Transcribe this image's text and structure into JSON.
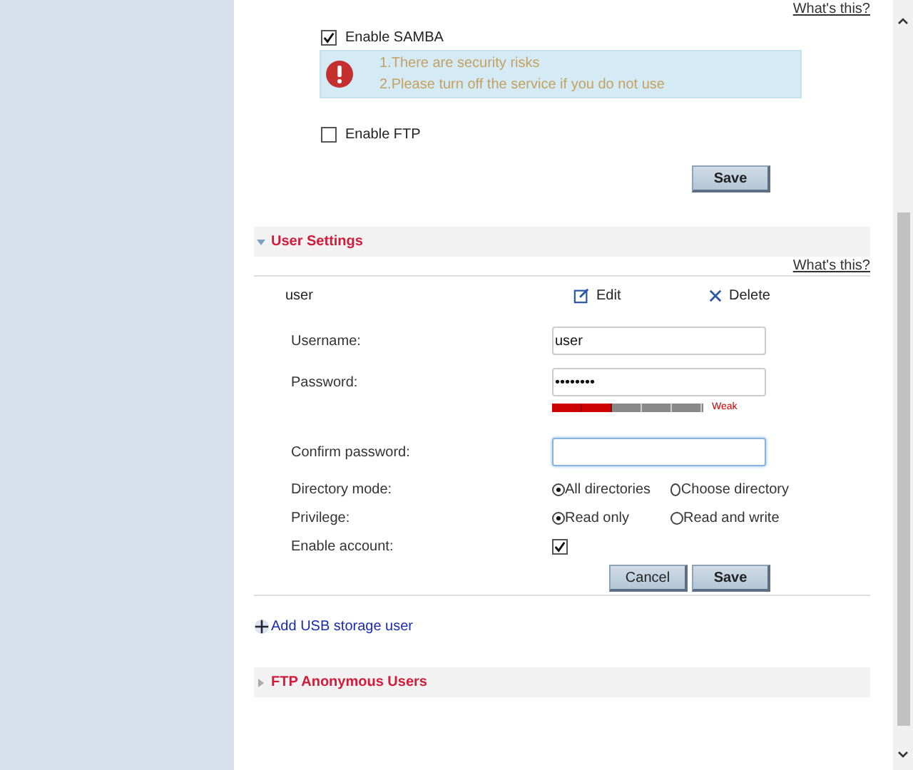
{
  "top_help_link": "What's this?",
  "services": [
    {
      "label": "Enable SAMBA",
      "checked": true
    },
    {
      "label": "Enable FTP",
      "checked": false
    }
  ],
  "samba_alert": {
    "lines": [
      "1.There are security risks",
      "2.Please turn off the service if you do not use"
    ]
  },
  "services_save": "Save",
  "user_settings": {
    "title": "User Settings",
    "expanded": true,
    "help_link": "What's this?",
    "user": {
      "name": "user",
      "edit": "Edit",
      "delete": "Delete"
    },
    "form": {
      "username": {
        "label": "Username:",
        "value": "user"
      },
      "password": {
        "label": "Password:",
        "value": "••••••••",
        "strength": {
          "level": 0.4,
          "label": "Weak"
        }
      },
      "confirm": {
        "label": "Confirm password:",
        "focused": true
      },
      "directory_mode": {
        "label": "Directory mode:",
        "options": [
          {
            "label": "All directories",
            "selected": true
          },
          {
            "label": "Choose directory",
            "selected": false
          }
        ]
      },
      "privilege": {
        "label": "Privilege:",
        "options": [
          {
            "label": "Read only",
            "selected": true
          },
          {
            "label": "Read and write",
            "selected": false
          }
        ]
      },
      "enable_account": {
        "label": "Enable account:",
        "checked": true
      },
      "buttons": [
        "Cancel",
        "Save"
      ]
    },
    "add_user": "Add USB storage user"
  },
  "ftp_anonymous": {
    "title": "FTP Anonymous Users",
    "expanded": false
  }
}
